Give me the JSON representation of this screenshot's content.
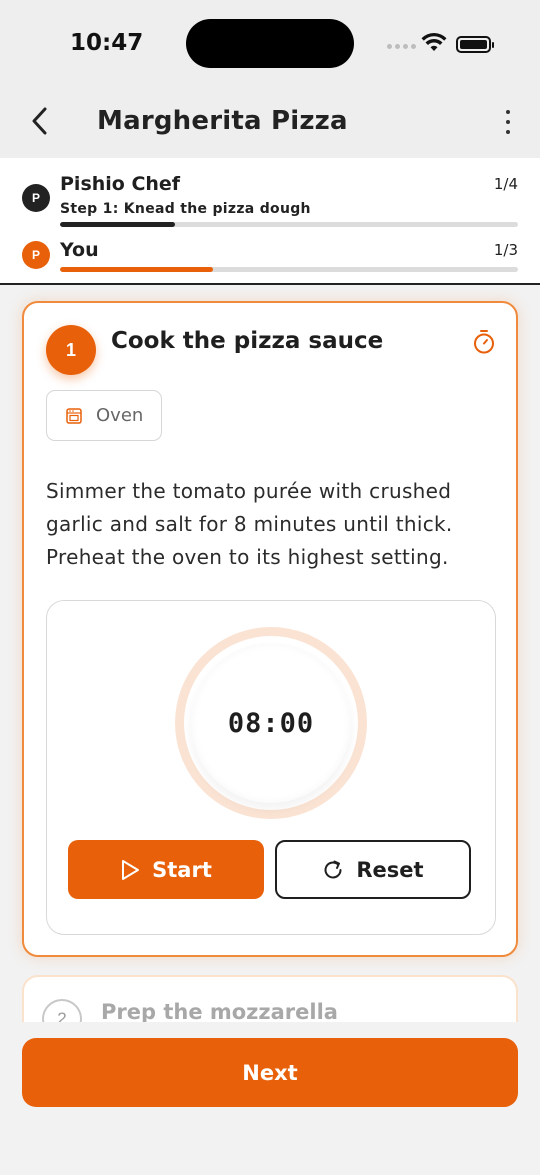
{
  "status_bar": {
    "time": "10:47"
  },
  "header": {
    "title": "Margherita Pizza"
  },
  "progress": {
    "chef": {
      "initial": "P",
      "name": "Pishio Chef",
      "count": "1/4",
      "step": "Step 1: Knead the pizza dough",
      "fraction": 0.25,
      "color": "#222222"
    },
    "you": {
      "initial": "P",
      "name": "You",
      "count": "1/3",
      "fraction": 0.333,
      "color": "#e8600a"
    }
  },
  "current_step": {
    "number": "1",
    "title": "Cook the pizza sauce",
    "equipment": "Oven",
    "description": "Simmer the tomato purée with crushed garlic and salt for 8 minutes until thick. Preheat the oven to its highest setting.",
    "timer": "08:00",
    "start_label": "Start",
    "reset_label": "Reset"
  },
  "next_step": {
    "number": "2",
    "title": "Prep the mozzarella"
  },
  "footer": {
    "next_label": "Next"
  },
  "colors": {
    "accent": "#e8600a",
    "accent_light": "#fbe3d3",
    "border_accent": "#f08a3c"
  }
}
